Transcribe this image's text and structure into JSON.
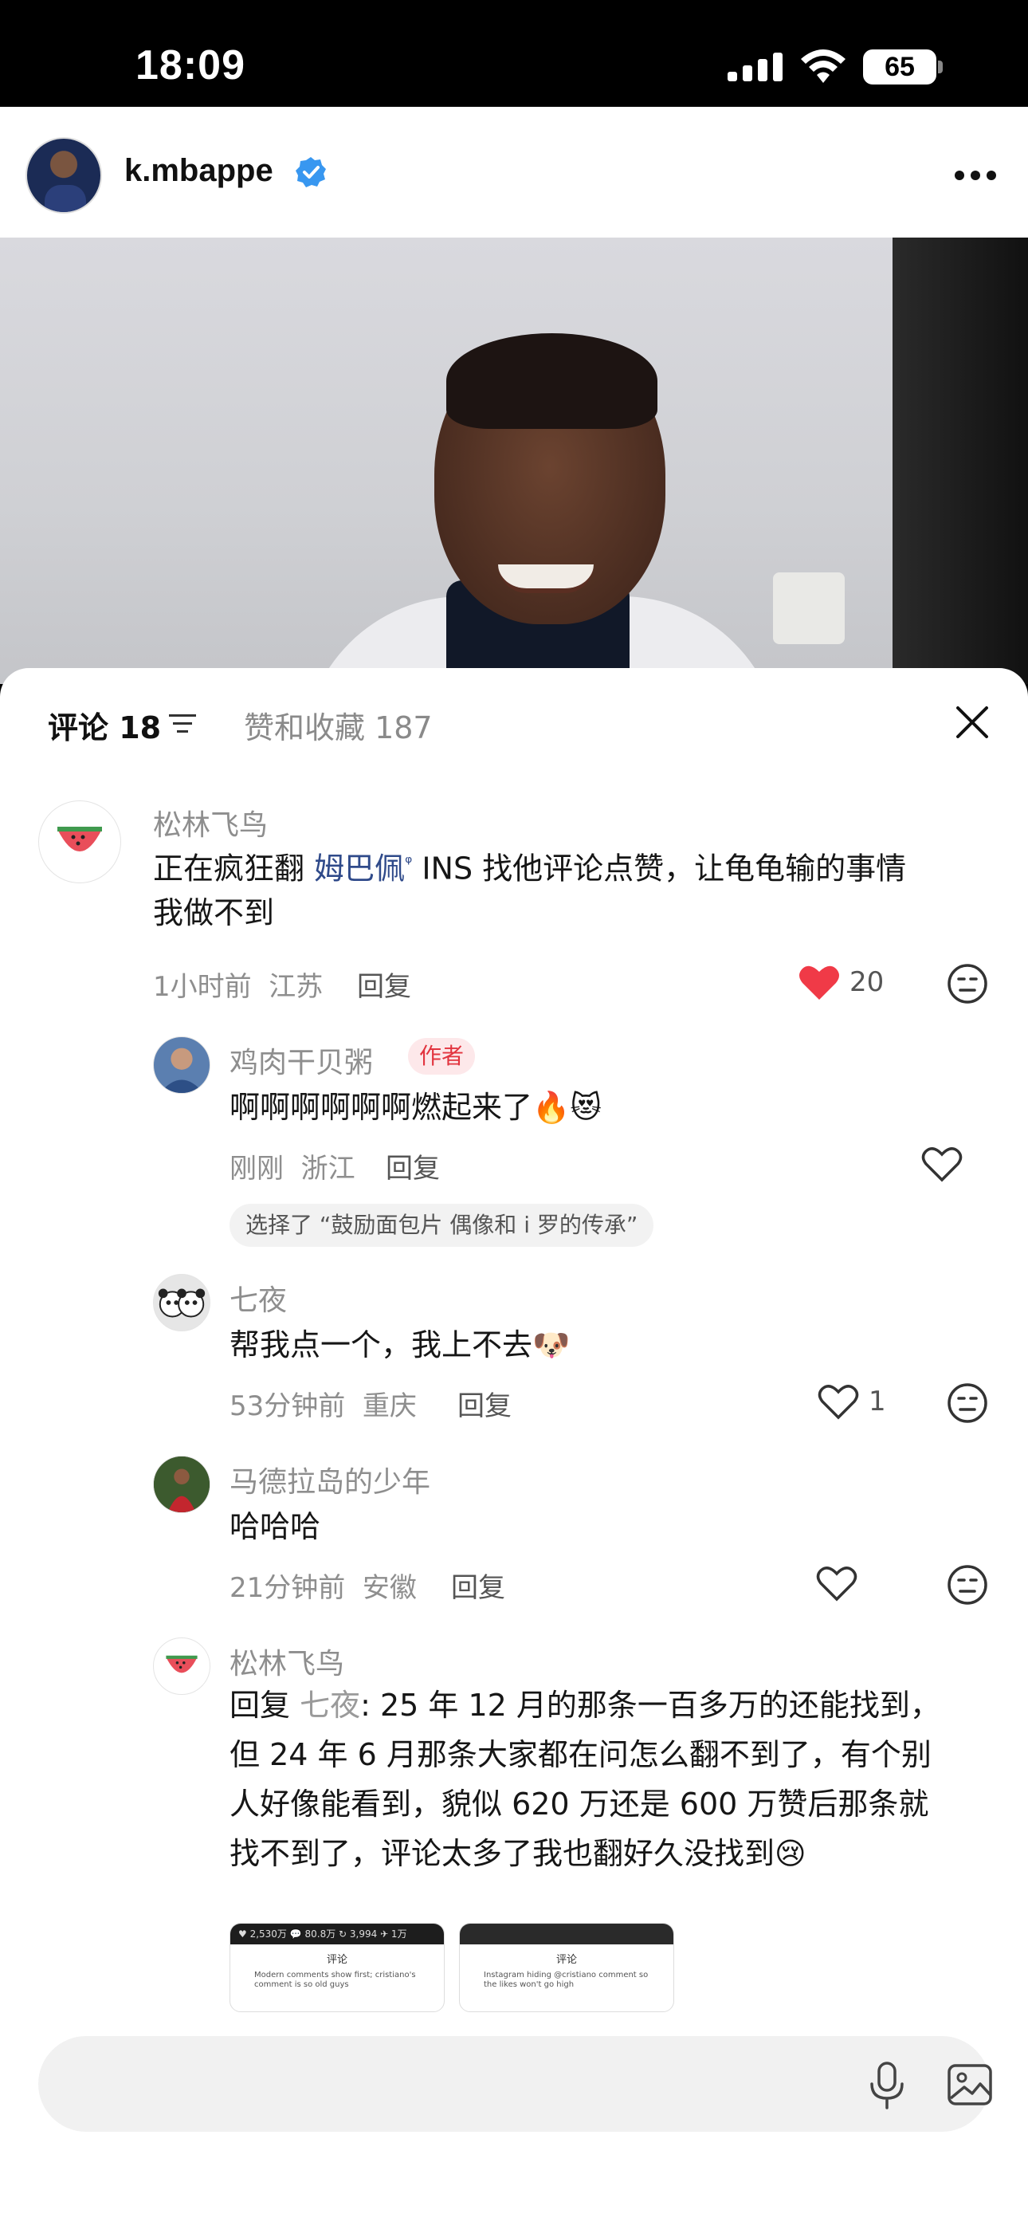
{
  "status_bar": {
    "time": "18:09",
    "battery": "65"
  },
  "header": {
    "username": "k.mbappe"
  },
  "tabs": {
    "comments_label": "评论 18",
    "likes_label": "赞和收藏 187"
  },
  "comments": [
    {
      "name": "松林飞鸟",
      "text_pre": "正在疯狂翻 ",
      "mention": "姆巴佩",
      "text_post": " INS 找他评论点赞，让龟龟输的事情",
      "text_line2": "我做不到",
      "time": "1小时前",
      "location": "江苏",
      "reply": "回复",
      "likes": "20"
    },
    {
      "name": "鸡肉干贝粥",
      "tag": "作者",
      "text": "啊啊啊啊啊啊燃起来了🔥😻",
      "time": "刚刚",
      "location": "浙江",
      "reply": "回复",
      "chip": "选择了 “鼓励面包片 偶像和 i 罗的传承”"
    },
    {
      "name": "七夜",
      "text": "帮我点一个，我上不去🐶",
      "time": "53分钟前",
      "location": "重庆",
      "reply": "回复",
      "likes": "1"
    },
    {
      "name": "马德拉岛的少年",
      "text": "哈哈哈",
      "time": "21分钟前",
      "location": "安徽",
      "reply": "回复"
    },
    {
      "name": "松林飞鸟",
      "reply_prefix": "回复 ",
      "reply_to": "七夜",
      "line1": ": 25 年 12 月的那条一百多万的还能找到，",
      "line2": "但 24 年 6 月那条大家都在问怎么翻不到了，有个别",
      "line3": "人好像能看到，貌似 620 万还是 600 万赞后那条就",
      "line4": "找不到了，评论太多了我也翻好久没找到😢",
      "thumbs": [
        {
          "stats": "♥ 2,530万  💬 80.8万  ↻ 3,994  ✈ 1万",
          "title": "评论",
          "text": "Modern comments show first; cristiano's comment is so old guys"
        },
        {
          "stats": "",
          "title": "评论",
          "text": "Instagram hiding @cristiano comment so the likes won't go high"
        }
      ]
    }
  ],
  "input": {
    "placeholder": ""
  },
  "colors": {
    "like_red": "#f03a47",
    "verified_blue": "#3897f0",
    "author_tag_bg": "#fde8ea"
  },
  "icons": [
    "signal-icon",
    "wifi-icon",
    "verified-icon",
    "more-icon",
    "sort-icon",
    "close-icon",
    "heart-icon",
    "emoji-icon",
    "mic-icon",
    "image-icon"
  ]
}
